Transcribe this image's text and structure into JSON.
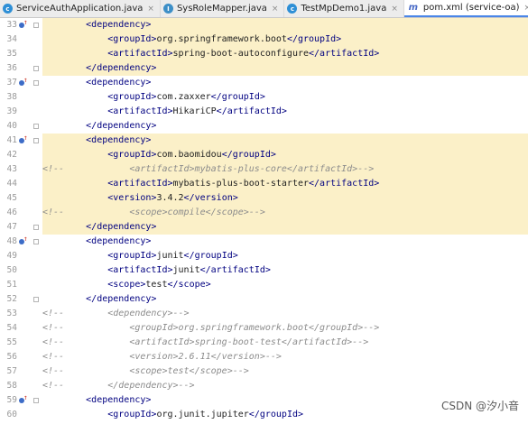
{
  "tabs": [
    {
      "label": "ServiceAuthApplication.java",
      "icon": "java-class-icon",
      "active": false
    },
    {
      "label": "SysRoleMapper.java",
      "icon": "java-interface-icon",
      "active": false
    },
    {
      "label": "TestMpDemo1.java",
      "icon": "java-test-icon",
      "active": false
    },
    {
      "label": "pom.xml (service-oa)",
      "icon": "maven-xml-icon",
      "active": true
    }
  ],
  "close_glyph": "×",
  "highlight_color": "#fbf0c8",
  "lines": [
    {
      "num": "33",
      "marker": true,
      "fold": true,
      "hl": true,
      "tokens": [
        [
          "t",
          "        <dependency>"
        ]
      ]
    },
    {
      "num": "34",
      "marker": false,
      "fold": false,
      "hl": true,
      "tokens": [
        [
          "t",
          "            <groupId>"
        ],
        [
          "x",
          "org.springframework.boot"
        ],
        [
          "t",
          "</groupId>"
        ]
      ]
    },
    {
      "num": "35",
      "marker": false,
      "fold": false,
      "hl": true,
      "tokens": [
        [
          "t",
          "            <artifactId>"
        ],
        [
          "x",
          "spring-boot-autoconfigure"
        ],
        [
          "t",
          "</artifactId>"
        ]
      ]
    },
    {
      "num": "36",
      "marker": false,
      "fold": true,
      "hl": true,
      "tokens": [
        [
          "t",
          "        </dependency>"
        ]
      ]
    },
    {
      "num": "37",
      "marker": true,
      "fold": true,
      "hl": false,
      "tokens": [
        [
          "t",
          "        <dependency>"
        ]
      ]
    },
    {
      "num": "38",
      "marker": false,
      "fold": false,
      "hl": false,
      "tokens": [
        [
          "t",
          "            <groupId>"
        ],
        [
          "x",
          "com.zaxxer"
        ],
        [
          "t",
          "</groupId>"
        ]
      ]
    },
    {
      "num": "39",
      "marker": false,
      "fold": false,
      "hl": false,
      "tokens": [
        [
          "t",
          "            <artifactId>"
        ],
        [
          "x",
          "HikariCP"
        ],
        [
          "t",
          "</artifactId>"
        ]
      ]
    },
    {
      "num": "40",
      "marker": false,
      "fold": true,
      "hl": false,
      "tokens": [
        [
          "t",
          "        </dependency>"
        ]
      ]
    },
    {
      "num": "41",
      "marker": true,
      "fold": true,
      "hl": true,
      "tokens": [
        [
          "t",
          "        <dependency>"
        ]
      ]
    },
    {
      "num": "42",
      "marker": false,
      "fold": false,
      "hl": true,
      "tokens": [
        [
          "t",
          "            <groupId>"
        ],
        [
          "x",
          "com.baomidou"
        ],
        [
          "t",
          "</groupId>"
        ]
      ]
    },
    {
      "num": "43",
      "marker": false,
      "fold": false,
      "hl": true,
      "tokens": [
        [
          "c",
          "<!--            <artifactId>mybatis-plus-core</artifactId>-->"
        ]
      ]
    },
    {
      "num": "44",
      "marker": false,
      "fold": false,
      "hl": true,
      "tokens": [
        [
          "t",
          "            <artifactId>"
        ],
        [
          "x",
          "mybatis-plus-boot-starter"
        ],
        [
          "t",
          "</artifactId>"
        ]
      ]
    },
    {
      "num": "45",
      "marker": false,
      "fold": false,
      "hl": true,
      "tokens": [
        [
          "t",
          "            <version>"
        ],
        [
          "x",
          "3.4.2"
        ],
        [
          "t",
          "</version>"
        ]
      ]
    },
    {
      "num": "46",
      "marker": false,
      "fold": false,
      "hl": true,
      "tokens": [
        [
          "c",
          "<!--            <scope>compile</scope>-->"
        ]
      ]
    },
    {
      "num": "47",
      "marker": false,
      "fold": true,
      "hl": true,
      "tokens": [
        [
          "t",
          "        </dependency>"
        ]
      ]
    },
    {
      "num": "48",
      "marker": true,
      "fold": true,
      "hl": false,
      "tokens": [
        [
          "t",
          "        <dependency>"
        ]
      ]
    },
    {
      "num": "49",
      "marker": false,
      "fold": false,
      "hl": false,
      "tokens": [
        [
          "t",
          "            <groupId>"
        ],
        [
          "x",
          "junit"
        ],
        [
          "t",
          "</groupId>"
        ]
      ]
    },
    {
      "num": "50",
      "marker": false,
      "fold": false,
      "hl": false,
      "tokens": [
        [
          "t",
          "            <artifactId>"
        ],
        [
          "x",
          "junit"
        ],
        [
          "t",
          "</artifactId>"
        ]
      ]
    },
    {
      "num": "51",
      "marker": false,
      "fold": false,
      "hl": false,
      "tokens": [
        [
          "t",
          "            <scope>"
        ],
        [
          "x",
          "test"
        ],
        [
          "t",
          "</scope>"
        ]
      ]
    },
    {
      "num": "52",
      "marker": false,
      "fold": true,
      "hl": false,
      "tokens": [
        [
          "t",
          "        </dependency>"
        ]
      ]
    },
    {
      "num": "53",
      "marker": false,
      "fold": false,
      "hl": false,
      "tokens": [
        [
          "c",
          "<!--        <dependency>-->"
        ]
      ]
    },
    {
      "num": "54",
      "marker": false,
      "fold": false,
      "hl": false,
      "tokens": [
        [
          "c",
          "<!--            <groupId>org.springframework.boot</groupId>-->"
        ]
      ]
    },
    {
      "num": "55",
      "marker": false,
      "fold": false,
      "hl": false,
      "tokens": [
        [
          "c",
          "<!--            <artifactId>spring-boot-test</artifactId>-->"
        ]
      ]
    },
    {
      "num": "56",
      "marker": false,
      "fold": false,
      "hl": false,
      "tokens": [
        [
          "c",
          "<!--            <version>2.6.11</version>-->"
        ]
      ]
    },
    {
      "num": "57",
      "marker": false,
      "fold": false,
      "hl": false,
      "tokens": [
        [
          "c",
          "<!--            <scope>test</scope>-->"
        ]
      ]
    },
    {
      "num": "58",
      "marker": false,
      "fold": false,
      "hl": false,
      "tokens": [
        [
          "c",
          "<!--        </dependency>-->"
        ]
      ]
    },
    {
      "num": "59",
      "marker": true,
      "fold": true,
      "hl": false,
      "tokens": [
        [
          "t",
          "        <dependency>"
        ]
      ]
    },
    {
      "num": "60",
      "marker": false,
      "fold": false,
      "hl": false,
      "tokens": [
        [
          "t",
          "            <groupId>"
        ],
        [
          "x",
          "org.junit.jupiter"
        ],
        [
          "t",
          "</groupId>"
        ]
      ]
    }
  ],
  "watermark": "CSDN @汐小音"
}
